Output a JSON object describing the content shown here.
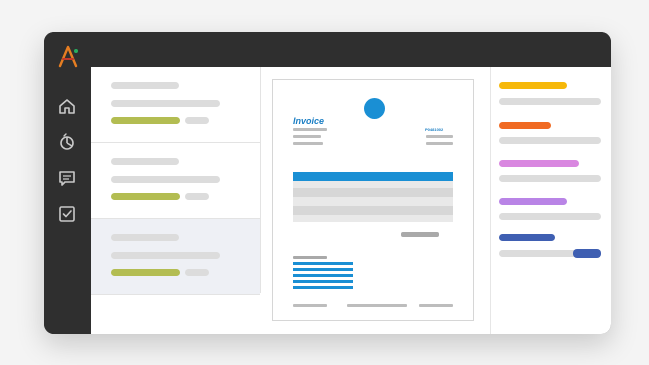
{
  "invoice": {
    "title": "Invoice",
    "number": "P0481002"
  },
  "colors": {
    "rail": "#2f2f2f",
    "accent": "#1a8fd4",
    "status_green": "#b3bd52",
    "tag_colors": [
      "#f6b80a",
      "#f06a22",
      "#d987e0",
      "#b984e6",
      "#3f5fb2"
    ],
    "toggle": "#3f5fb2"
  },
  "icons": {
    "logo": "logo-icon",
    "nav": [
      "home-icon",
      "analytics-icon",
      "message-icon",
      "checklist-icon"
    ]
  }
}
